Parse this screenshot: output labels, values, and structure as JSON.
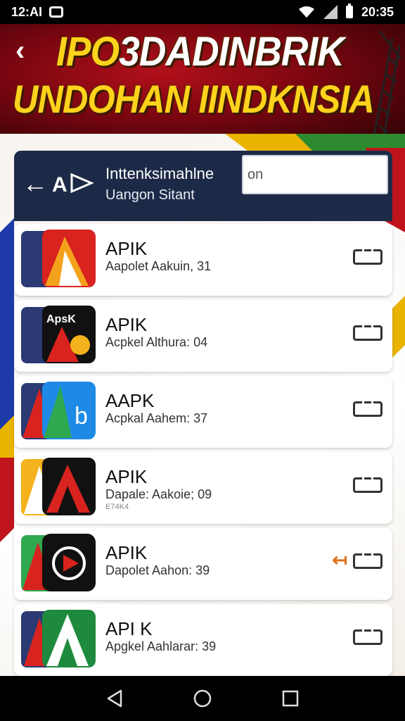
{
  "status_bar": {
    "carrier_time_left": "12:AI",
    "clock": "20:35"
  },
  "hero": {
    "line1_a": "IPO",
    "line1_b": "3DADINBRIK",
    "line2": "UNDOHAN IINDKNSIA"
  },
  "header": {
    "back_glyph": "←",
    "logo_text": "A",
    "title": "Inttenksimahlne",
    "subtitle": "Uangon Sitant",
    "search_value": "on"
  },
  "apps": [
    {
      "name": "APIK",
      "subtitle": "Aapolet Aakuin, 31",
      "note": ""
    },
    {
      "name": "APIK",
      "subtitle": "Acpkel Althura: 04",
      "note": ""
    },
    {
      "name": "AAPK",
      "subtitle": "Acpkal Aahem: 37",
      "note": ""
    },
    {
      "name": "APIK",
      "subtitle": "Dapale: Aakoie; 09",
      "note": "E74K4"
    },
    {
      "name": "APIK",
      "subtitle": "Dapolet Aahon: 39",
      "note": ""
    },
    {
      "name": "API K",
      "subtitle": "Apgkel Aahlarar: 39",
      "note": ""
    }
  ],
  "icons": {
    "back": "back-arrow-icon",
    "wifi": "wifi-icon",
    "signal": "signal-icon",
    "battery": "battery-icon",
    "download": "download-icon",
    "nav_back": "nav-back-icon",
    "nav_home": "nav-home-icon",
    "nav_recents": "nav-recents-icon"
  },
  "colors": {
    "header_bg": "#1d2a47",
    "hero_red": "#b2101a",
    "hero_yellow": "#ffd21c",
    "accent_orange": "#e0721c"
  }
}
